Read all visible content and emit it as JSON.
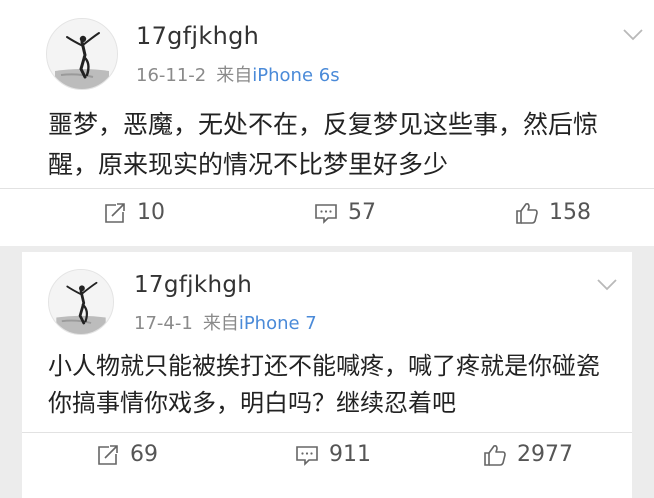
{
  "posts": [
    {
      "username": "17gfjkhgh",
      "date": "16-11-2",
      "source_prefix": "来自",
      "device": "iPhone 6s",
      "text_line1": "噩梦，恶魔，无处不在，反复梦见这些事，然后惊",
      "text_line2": "醒，原来现实的情况不比梦里好多少",
      "reposts": "10",
      "comments": "57",
      "likes": "158"
    },
    {
      "username": "17gfjkhgh",
      "date": "17-4-1",
      "source_prefix": "来自",
      "device": "iPhone 7",
      "text_line1": "小人物就只能被挨打还不能喊疼，喊了疼就是你碰瓷",
      "text_line2": "你搞事情你戏多，明白吗？继续忍着吧",
      "reposts": "69",
      "comments": "911",
      "likes": "2977"
    }
  ],
  "colors": {
    "link_blue": "#4a8ad8",
    "meta_gray": "#8a8a8a",
    "background": "#ececec"
  },
  "icons": [
    "dancer-avatar",
    "chevron-down-icon",
    "repost-icon",
    "comment-icon",
    "like-icon"
  ]
}
